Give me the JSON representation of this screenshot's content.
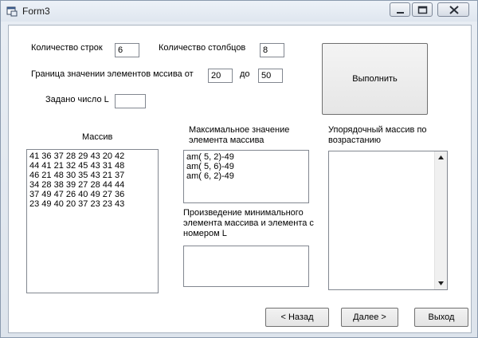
{
  "window": {
    "title": "Form3"
  },
  "form": {
    "rows_label": "Количество строк",
    "rows_value": "6",
    "cols_label": "Количество столбцов",
    "cols_value": "8",
    "range_label": "Граница значении элементов мссива от",
    "range_from": "20",
    "range_to_label": "до",
    "range_to": "50",
    "number_label": "Задано число L",
    "number_value": "",
    "execute_label": "Выполнить"
  },
  "array_panel": {
    "label": "Массив",
    "rows": [
      "41 36 37 28 29 43 20 42",
      "44 41 21 32 45 43 31 48",
      "46 21 48 30 35 43 21 37",
      "34 28 38 39 27 28 44 44",
      "37 49 47 26 40 49 27 36",
      "23 49 40 20 37 23 23 43"
    ]
  },
  "max_panel": {
    "label": "Максимальное значение элемента массива",
    "items": [
      "am( 5, 2)-49",
      "am( 5, 6)-49",
      "am( 6, 2)-49"
    ]
  },
  "product_panel": {
    "label": "Произведение минимального элемента массива и элемента с номером L",
    "value": ""
  },
  "sorted_panel": {
    "label": "Упорядочный массив по возрастанию"
  },
  "footer": {
    "back_label": "< Назад",
    "next_label": "Далее >",
    "exit_label": "Выход"
  }
}
